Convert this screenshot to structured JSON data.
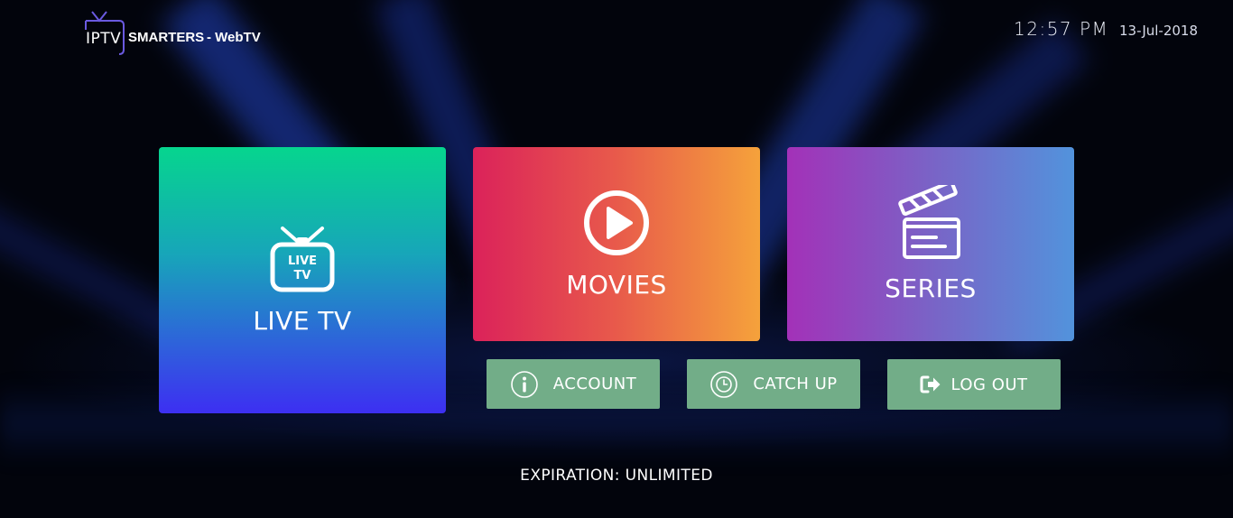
{
  "brand": {
    "iptv": "IPTV",
    "smarters": "SMARTERS",
    "webtv": "- WebTV",
    "accent": "#6a5ae0"
  },
  "header": {
    "time": "12:57 PM",
    "date": "13-Jul-2018"
  },
  "tiles": [
    {
      "id": "live_tv",
      "label": "LIVE TV",
      "icon": "tv-icon",
      "icon_text": [
        "LIVE",
        "TV"
      ]
    },
    {
      "id": "movies",
      "label": "MOVIES",
      "icon": "play-circle-icon"
    },
    {
      "id": "series",
      "label": "SERIES",
      "icon": "clapperboard-icon"
    }
  ],
  "buttons": [
    {
      "id": "account",
      "label": "ACCOUNT",
      "icon": "info-circle-icon"
    },
    {
      "id": "catch_up",
      "label": "CATCH UP",
      "icon": "clock-icon"
    },
    {
      "id": "log_out",
      "label": "LOG OUT",
      "icon": "sign-out-icon"
    }
  ],
  "footer": {
    "expiration": "EXPIRATION: UNLIMITED"
  },
  "colors": {
    "button": "#72ad88",
    "live_tv_gradient": [
      "#06d58e",
      "#3d2ff2"
    ],
    "movies_gradient": [
      "#db225a",
      "#f5a23b"
    ],
    "series_gradient": [
      "#a331b8",
      "#5293dc"
    ]
  }
}
